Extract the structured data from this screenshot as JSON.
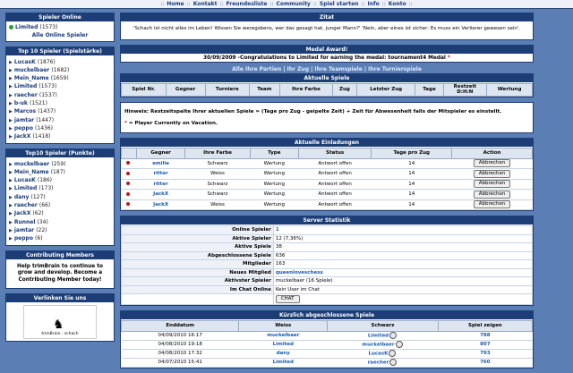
{
  "topnav": [
    "Home",
    "Kontakt",
    "Freundesliste",
    "Community",
    "Spiel starten",
    "Info",
    "Konto"
  ],
  "sidebar": {
    "online": {
      "title": "Spieler Online",
      "user": "Limited",
      "user_count": "(1573)",
      "all_link": "Alle Online Spieler"
    },
    "top_strength": {
      "title": "Top 10 Spieler (Spielstärke)",
      "items": [
        {
          "name": "LucasK",
          "count": "(1876)"
        },
        {
          "name": "muckelbaer",
          "count": "(1682)"
        },
        {
          "name": "Mein_Name",
          "count": "(1659)"
        },
        {
          "name": "Limited",
          "count": "(1573)"
        },
        {
          "name": "raecher",
          "count": "(1537)"
        },
        {
          "name": "b-uk",
          "count": "(1521)"
        },
        {
          "name": "Marcos",
          "count": "(1437)"
        },
        {
          "name": "jamtar",
          "count": "(1447)"
        },
        {
          "name": "peppo",
          "count": "(1436)"
        },
        {
          "name": "JackX",
          "count": "(1418)"
        }
      ]
    },
    "top_points": {
      "title": "Top10 Spieler (Punkte)",
      "items": [
        {
          "name": "muckelbaer",
          "count": "(259)"
        },
        {
          "name": "Mein_Name",
          "count": "(187)"
        },
        {
          "name": "LucasK",
          "count": "(186)"
        },
        {
          "name": "Limited",
          "count": "(173)"
        },
        {
          "name": "dany",
          "count": "(127)"
        },
        {
          "name": "raecher",
          "count": "(66)"
        },
        {
          "name": "JackX",
          "count": "(62)"
        },
        {
          "name": "Runnel",
          "count": "(34)"
        },
        {
          "name": "jamtar",
          "count": "(22)"
        },
        {
          "name": "peppo",
          "count": "(6)"
        }
      ]
    },
    "contrib": {
      "title": "Contributing Members",
      "text": "Help trimBrain to continue to grow and develop. Become a Contributing Member today!"
    },
    "link": {
      "title": "Verlinken Sie uns",
      "logo_text": "trimBrain : schach"
    }
  },
  "main": {
    "quote": {
      "title": "Zitat",
      "text": "'Schach ist nicht alles im Leben! Wissen Sie weregsbens, wer das gesagt hat, junger Mann?' 'Nein, aber eines ist sicher: Es muss ein Verlierer gewesen sein'."
    },
    "medal": {
      "title": "Medal Award!",
      "text": "30/09/2009 -Congratulations to Limited for earning the medal: tournament4 Medal"
    },
    "gamelinks": [
      "Alle Ihre Partien",
      "Ihr Zug",
      "Ihre Teamspiele",
      "Ihre Turnierspiele"
    ],
    "current_games": {
      "title": "Aktuelle Spiele",
      "headers": [
        "Spiel Nr.",
        "Gegner",
        "Turniere",
        "Team",
        "Ihre Farbe",
        "Zug",
        "Letzter Zug",
        "Tage",
        "Restzeit\nD:H:N",
        "Wertung"
      ]
    },
    "hint": {
      "line1": "Hinweis: Restzeitspalte Ihrer aktuellen Spiele = (Tage pro Zug - geipelte Zeit) + Zeit für Abwesenheit falls der Mitspieler es einstellt.",
      "line2": "= Player Currently on Vacation."
    },
    "invites": {
      "title": "Aktuelle Einladungen",
      "headers": [
        "Gegner",
        "Ihre Farbe",
        "Type",
        "Status",
        "Tage pro Zug",
        "Action"
      ],
      "rows": [
        {
          "opp": "emilie",
          "color": "Schwarz",
          "type": "Wertung",
          "status": "Antwort offen",
          "days": "14",
          "action": "Abbrechen"
        },
        {
          "opp": "ritter",
          "color": "Weiss",
          "type": "Wertung",
          "status": "Antwort offen",
          "days": "14",
          "action": "Abbrechen"
        },
        {
          "opp": "ritter",
          "color": "Schwarz",
          "type": "Wertung",
          "status": "Antwort offen",
          "days": "14",
          "action": "Abbrechen"
        },
        {
          "opp": "JackX",
          "color": "Schwarz",
          "type": "Wertung",
          "status": "Antwort offen",
          "days": "14",
          "action": "Abbrechen"
        },
        {
          "opp": "JackX",
          "color": "Weiss",
          "type": "Wertung",
          "status": "Antwort offen",
          "days": "14",
          "action": "Abbrechen"
        }
      ]
    },
    "server": {
      "title": "Server Statistik",
      "rows": [
        {
          "k": "Online Spieler",
          "v": "1"
        },
        {
          "k": "Aktive Spieler",
          "v": "12 (7,36%)"
        },
        {
          "k": "Aktive Spiele",
          "v": "38"
        },
        {
          "k": "Abgeschlossene Spiele",
          "v": "636"
        },
        {
          "k": "Mitglieder",
          "v": "163"
        },
        {
          "k": "Neues Mitglied",
          "v": "queenloveschess"
        },
        {
          "k": "Aktivster Spieler",
          "v": "muckelbaer (16 Spiele)"
        },
        {
          "k": "Im Chat Online",
          "v": "Kein User im Chat"
        }
      ],
      "chat_button": "CHAT"
    },
    "recent": {
      "title": "Kürzlich abgeschlossene Spiele",
      "headers": [
        "Enddatum",
        "Weiss",
        "Schwarz",
        "Spiel zeigen"
      ],
      "rows": [
        {
          "date": "04/09/2010 16:17",
          "white": "muckelbaer",
          "black": "Limited",
          "game": "788"
        },
        {
          "date": "04/08/2010 19:18",
          "white": "Limited",
          "black": "muckelbaer",
          "game": "807"
        },
        {
          "date": "04/08/2010 17:32",
          "white": "dany",
          "black": "LucasK",
          "game": "793"
        },
        {
          "date": "04/07/2010 15:41",
          "white": "Limited",
          "black": "raecher",
          "game": "760"
        }
      ]
    }
  }
}
